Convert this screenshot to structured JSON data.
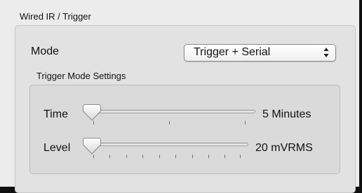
{
  "group": {
    "title": "Wired IR / Trigger"
  },
  "mode": {
    "label": "Mode",
    "selected": "Trigger + Serial"
  },
  "trigger_settings": {
    "title": "Trigger Mode Settings",
    "time": {
      "label": "Time",
      "value_text": "5 Minutes",
      "position": 0.0
    },
    "level": {
      "label": "Level",
      "value_text": "20 mVRMS",
      "position": 0.0
    }
  },
  "icons": {
    "popup": "up-down-arrows-icon",
    "knob": "slider-knob"
  }
}
